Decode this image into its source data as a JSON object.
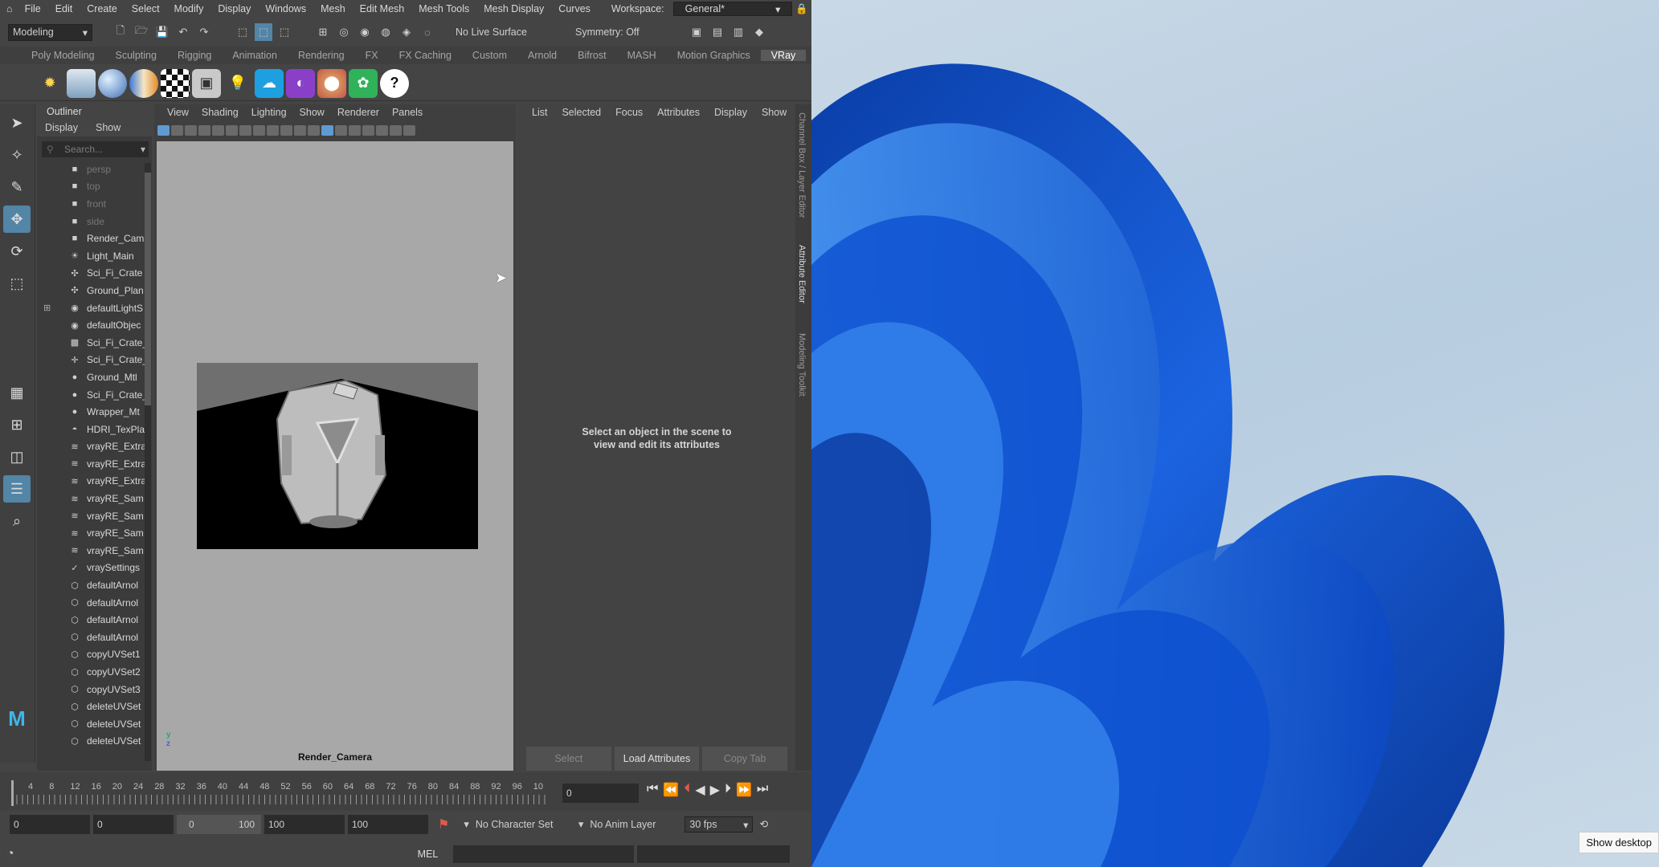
{
  "menubar": {
    "items": [
      "File",
      "Edit",
      "Create",
      "Select",
      "Modify",
      "Display",
      "Windows",
      "Mesh",
      "Edit Mesh",
      "Mesh Tools",
      "Mesh Display",
      "Curves"
    ],
    "workspace_label": "Workspace:",
    "workspace_value": "General*"
  },
  "toolbar": {
    "mode": "Modeling",
    "live_surface": "No Live Surface",
    "symmetry": "Symmetry: Off"
  },
  "shelf_tabs": [
    "Poly Modeling",
    "Sculpting",
    "Rigging",
    "Animation",
    "Rendering",
    "FX",
    "FX Caching",
    "Custom",
    "Arnold",
    "Bifrost",
    "MASH",
    "Motion Graphics",
    "VRay"
  ],
  "shelf_active": "VRay",
  "outliner": {
    "title": "Outliner",
    "menu": [
      "Display",
      "Show"
    ],
    "search_placeholder": "Search...",
    "items": [
      {
        "label": "persp",
        "icon": "camera-icon",
        "dim": true
      },
      {
        "label": "top",
        "icon": "camera-icon",
        "dim": true
      },
      {
        "label": "front",
        "icon": "camera-icon",
        "dim": true
      },
      {
        "label": "side",
        "icon": "camera-icon",
        "dim": true
      },
      {
        "label": "Render_Cam",
        "icon": "camera-icon",
        "dim": false
      },
      {
        "label": "Light_Main",
        "icon": "light-icon",
        "dim": false
      },
      {
        "label": "Sci_Fi_Crate",
        "icon": "mesh-icon",
        "dim": false
      },
      {
        "label": "Ground_Plan",
        "icon": "mesh-icon",
        "dim": false
      },
      {
        "label": "defaultLightS",
        "icon": "set-icon",
        "dim": false
      },
      {
        "label": "defaultObjec",
        "icon": "set-icon",
        "dim": false
      },
      {
        "label": "Sci_Fi_Crate_",
        "icon": "texture-icon",
        "dim": false
      },
      {
        "label": "Sci_Fi_Crate_",
        "icon": "placement-icon",
        "dim": false
      },
      {
        "label": "Ground_Mtl",
        "icon": "material-icon",
        "dim": false
      },
      {
        "label": "Sci_Fi_Crate_",
        "icon": "material-icon",
        "dim": false
      },
      {
        "label": "Wrapper_Mt",
        "icon": "material-icon",
        "dim": false
      },
      {
        "label": "HDRI_TexPla",
        "icon": "hdri-icon",
        "dim": false
      },
      {
        "label": "vrayRE_Extra",
        "icon": "render-element-icon",
        "dim": false
      },
      {
        "label": "vrayRE_Extra",
        "icon": "render-element-icon",
        "dim": false
      },
      {
        "label": "vrayRE_Extra",
        "icon": "render-element-icon",
        "dim": false
      },
      {
        "label": "vrayRE_Sam",
        "icon": "render-element-icon",
        "dim": false
      },
      {
        "label": "vrayRE_Sam",
        "icon": "render-element-icon",
        "dim": false
      },
      {
        "label": "vrayRE_Sam",
        "icon": "render-element-icon",
        "dim": false
      },
      {
        "label": "vrayRE_Sam",
        "icon": "render-element-icon",
        "dim": false
      },
      {
        "label": "vraySettings",
        "icon": "vray-icon",
        "dim": false
      },
      {
        "label": "defaultArnol",
        "icon": "node-icon",
        "dim": false
      },
      {
        "label": "defaultArnol",
        "icon": "node-icon",
        "dim": false
      },
      {
        "label": "defaultArnol",
        "icon": "node-icon",
        "dim": false
      },
      {
        "label": "defaultArnol",
        "icon": "node-icon",
        "dim": false
      },
      {
        "label": "copyUVSet1",
        "icon": "node-icon",
        "dim": false
      },
      {
        "label": "copyUVSet2",
        "icon": "node-icon",
        "dim": false
      },
      {
        "label": "copyUVSet3",
        "icon": "node-icon",
        "dim": false
      },
      {
        "label": "deleteUVSet",
        "icon": "node-icon",
        "dim": false
      },
      {
        "label": "deleteUVSet",
        "icon": "node-icon",
        "dim": false
      },
      {
        "label": "deleteUVSet",
        "icon": "node-icon",
        "dim": false
      }
    ]
  },
  "viewport": {
    "menu": [
      "View",
      "Shading",
      "Lighting",
      "Show",
      "Renderer",
      "Panels"
    ],
    "camera": "Render_Camera"
  },
  "attribute_editor": {
    "menu": [
      "List",
      "Selected",
      "Focus",
      "Attributes",
      "Display",
      "Show"
    ],
    "message_line1": "Select an object in the scene to",
    "message_line2": "view and edit its attributes",
    "buttons": [
      "Select",
      "Load Attributes",
      "Copy Tab"
    ]
  },
  "side_tabs": [
    "Channel Box / Layer Editor",
    "Attribute Editor",
    "Modeling Toolkit"
  ],
  "timeline": {
    "ticks": [
      "4",
      "8",
      "12",
      "16",
      "20",
      "24",
      "28",
      "32",
      "36",
      "40",
      "44",
      "48",
      "52",
      "56",
      "60",
      "64",
      "68",
      "72",
      "76",
      "80",
      "84",
      "88",
      "92",
      "96",
      "10"
    ],
    "current_frame": "0"
  },
  "range": {
    "start": "0",
    "anim_start": "0",
    "slider_a": "0",
    "slider_b": "100",
    "end": "100",
    "anim_end": "100",
    "character_set": "No Character Set",
    "anim_layer": "No Anim Layer",
    "fps": "30 fps"
  },
  "command": {
    "lang": "MEL"
  },
  "taskbar_tooltip": "Show desktop",
  "colors": {
    "desktop_blue": "#1a5fd6",
    "accent": "#5285a6"
  }
}
